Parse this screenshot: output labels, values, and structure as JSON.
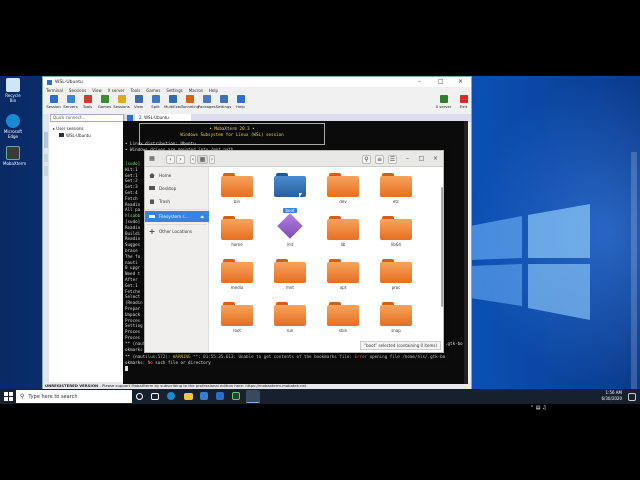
{
  "desktop": {
    "icons": [
      {
        "label": "Recycle Bin",
        "color": "#cfe6f7"
      },
      {
        "label": "Microsoft Edge",
        "color": "#1a8ad3"
      },
      {
        "label": "MobaXterm",
        "color": "#3a3a3a"
      }
    ]
  },
  "taskbar": {
    "search_placeholder": "Type here to search",
    "time": "1:56 AM",
    "date": "6/30/2020"
  },
  "moba": {
    "title": "WSL-Ubuntu",
    "menu": [
      "Terminal",
      "Sessions",
      "View",
      "X server",
      "Tools",
      "Games",
      "Settings",
      "Macros",
      "Help"
    ],
    "tools": [
      {
        "label": "Session",
        "color": "#2a6fc9"
      },
      {
        "label": "Servers",
        "color": "#3b86d6"
      },
      {
        "label": "Tools",
        "color": "#d03a2c"
      },
      {
        "label": "Games",
        "color": "#3a8c2f"
      },
      {
        "label": "Sessions",
        "color": "#e0a81a"
      },
      {
        "label": "View",
        "color": "#3a6bb0"
      },
      {
        "label": "Split",
        "color": "#4077c4"
      },
      {
        "label": "MultiExec",
        "color": "#2c6db7"
      },
      {
        "label": "Tunneling",
        "color": "#d3631d"
      },
      {
        "label": "Packages",
        "color": "#4a79c2"
      },
      {
        "label": "Settings",
        "color": "#3f6fb8"
      },
      {
        "label": "Help",
        "color": "#2c6fd1"
      }
    ],
    "right_tools": [
      {
        "label": "X server",
        "color": "#2f7d2f"
      },
      {
        "label": "Exit",
        "color": "#d62d2d"
      }
    ],
    "quick_connect": "Quick connect...",
    "tree": {
      "root": "User sessions",
      "child": "WSL-Ubuntu"
    },
    "side_tabs": [
      "Sessions",
      "Tools",
      "Macros"
    ],
    "tab_label": "2. WSL-Ubuntu",
    "status_bold": "UNREGISTERED VERSION",
    "status_text": " - Please support MobaXterm by subscribing to the professional edition here: https://mobaxterm.mobatek.net"
  },
  "terminal": {
    "banner_l1": "• MobaXterm 20.3 •",
    "banner_l2": "Windows Subsystem for Linux (WSL) session",
    "info_l1": "• Linux distribution: Ubuntu",
    "info_l2": "• Windows drives are mounted into /mnt path",
    "lines": [
      "[sudo]",
      "Hit:1",
      "Get:1",
      "Get:2",
      "Get:3",
      "Get:4",
      "Fetch",
      "Readin",
      "All pa",
      "hlsabb",
      "[sudo]",
      "Readin",
      "Buildi",
      "Readin",
      "Sugges",
      "  brase",
      "The fo",
      "  nauti",
      "0 upgr",
      "Need t",
      "After",
      "Get:1",
      "Fetche",
      "Select",
      "(Readin",
      "Prepar",
      "Unpack",
      "Proces",
      "Setting",
      "Proces",
      "Proces"
    ],
    "warn_prefix": "** (nautilus:572): ",
    "warn_word": "WARNING",
    "warn_mid": " **: 01:55:35.613: Unable to get contents of the bookmarks file: ",
    "warn_err": "Error",
    "warn_tail": " opening file /home/hls/.gtk-bo",
    "warn_l2a": "okmarks: ",
    "warn_l2b": "No",
    "warn_l2c": " such file or directory",
    "right_edge_1": ".gtk-bo",
    "right_edge_2": "",
    "input_line_1": "** (naut",
    "input_line_2": "okmarks"
  },
  "nautilus": {
    "sidebar": {
      "home": "Home",
      "desktop": "Desktop",
      "trash": "Trash",
      "filesystem": "Filesystem r...",
      "other": "Other Locations"
    },
    "folders": [
      {
        "name": "bin",
        "selected": false
      },
      {
        "name": "boot",
        "selected": true
      },
      {
        "name": "dev",
        "selected": false
      },
      {
        "name": "etc",
        "selected": false
      },
      {
        "name": "home",
        "selected": false
      },
      {
        "name": "init",
        "selected": false,
        "kind": "exec"
      },
      {
        "name": "lib",
        "selected": false
      },
      {
        "name": "lib64",
        "selected": false
      },
      {
        "name": "media",
        "selected": false
      },
      {
        "name": "mnt",
        "selected": false
      },
      {
        "name": "opt",
        "selected": false
      },
      {
        "name": "proc",
        "selected": false
      },
      {
        "name": "root",
        "selected": false
      },
      {
        "name": "run",
        "selected": false
      },
      {
        "name": "sbin",
        "selected": false
      },
      {
        "name": "snap",
        "selected": false
      }
    ],
    "status": "“boot” selected (containing 0 items)"
  }
}
